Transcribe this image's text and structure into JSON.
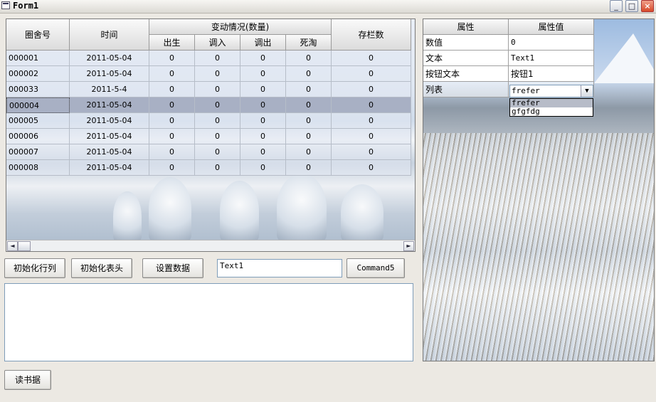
{
  "window": {
    "title": "Form1",
    "min": "_",
    "max": "□",
    "close": "×"
  },
  "grid": {
    "headers": {
      "pen": "圈舍号",
      "time": "时间",
      "group": "变动情况(数量)",
      "sub": [
        "出生",
        "调入",
        "调出",
        "死淘"
      ],
      "stock": "存栏数"
    },
    "rows": [
      [
        "000001",
        "2011-05-04",
        "0",
        "0",
        "0",
        "0",
        "0"
      ],
      [
        "000002",
        "2011-05-04",
        "0",
        "0",
        "0",
        "0",
        "0"
      ],
      [
        "000033",
        "2011-5-4",
        "0",
        "0",
        "0",
        "0",
        "0"
      ],
      [
        "000004",
        "2011-05-04",
        "0",
        "0",
        "0",
        "0",
        "0"
      ],
      [
        "000005",
        "2011-05-04",
        "0",
        "0",
        "0",
        "0",
        "0"
      ],
      [
        "000006",
        "2011-05-04",
        "0",
        "0",
        "0",
        "0",
        "0"
      ],
      [
        "000007",
        "2011-05-04",
        "0",
        "0",
        "0",
        "0",
        "0"
      ],
      [
        "000008",
        "2011-05-04",
        "0",
        "0",
        "0",
        "0",
        "0"
      ]
    ],
    "selected_row": 3,
    "scroll_left": "◄",
    "scroll_right": "►"
  },
  "buttons": {
    "init_rows": "初始化行列",
    "init_header": "初始化表头",
    "set_data": "设置数据",
    "command5": "Command5",
    "read_data": "读书据"
  },
  "text1": "Text1",
  "props": {
    "header_name": "属性",
    "header_value": "属性值",
    "rows": [
      {
        "name": "数值",
        "value": "0"
      },
      {
        "name": "文本",
        "value": "Text1"
      },
      {
        "name": "按钮文本",
        "value": "按钮1"
      },
      {
        "name": "列表",
        "value": ""
      }
    ],
    "combo_value": "frefer",
    "combo_arrow": "▼",
    "dropdown": [
      "frefer",
      "gfgfdg"
    ]
  }
}
